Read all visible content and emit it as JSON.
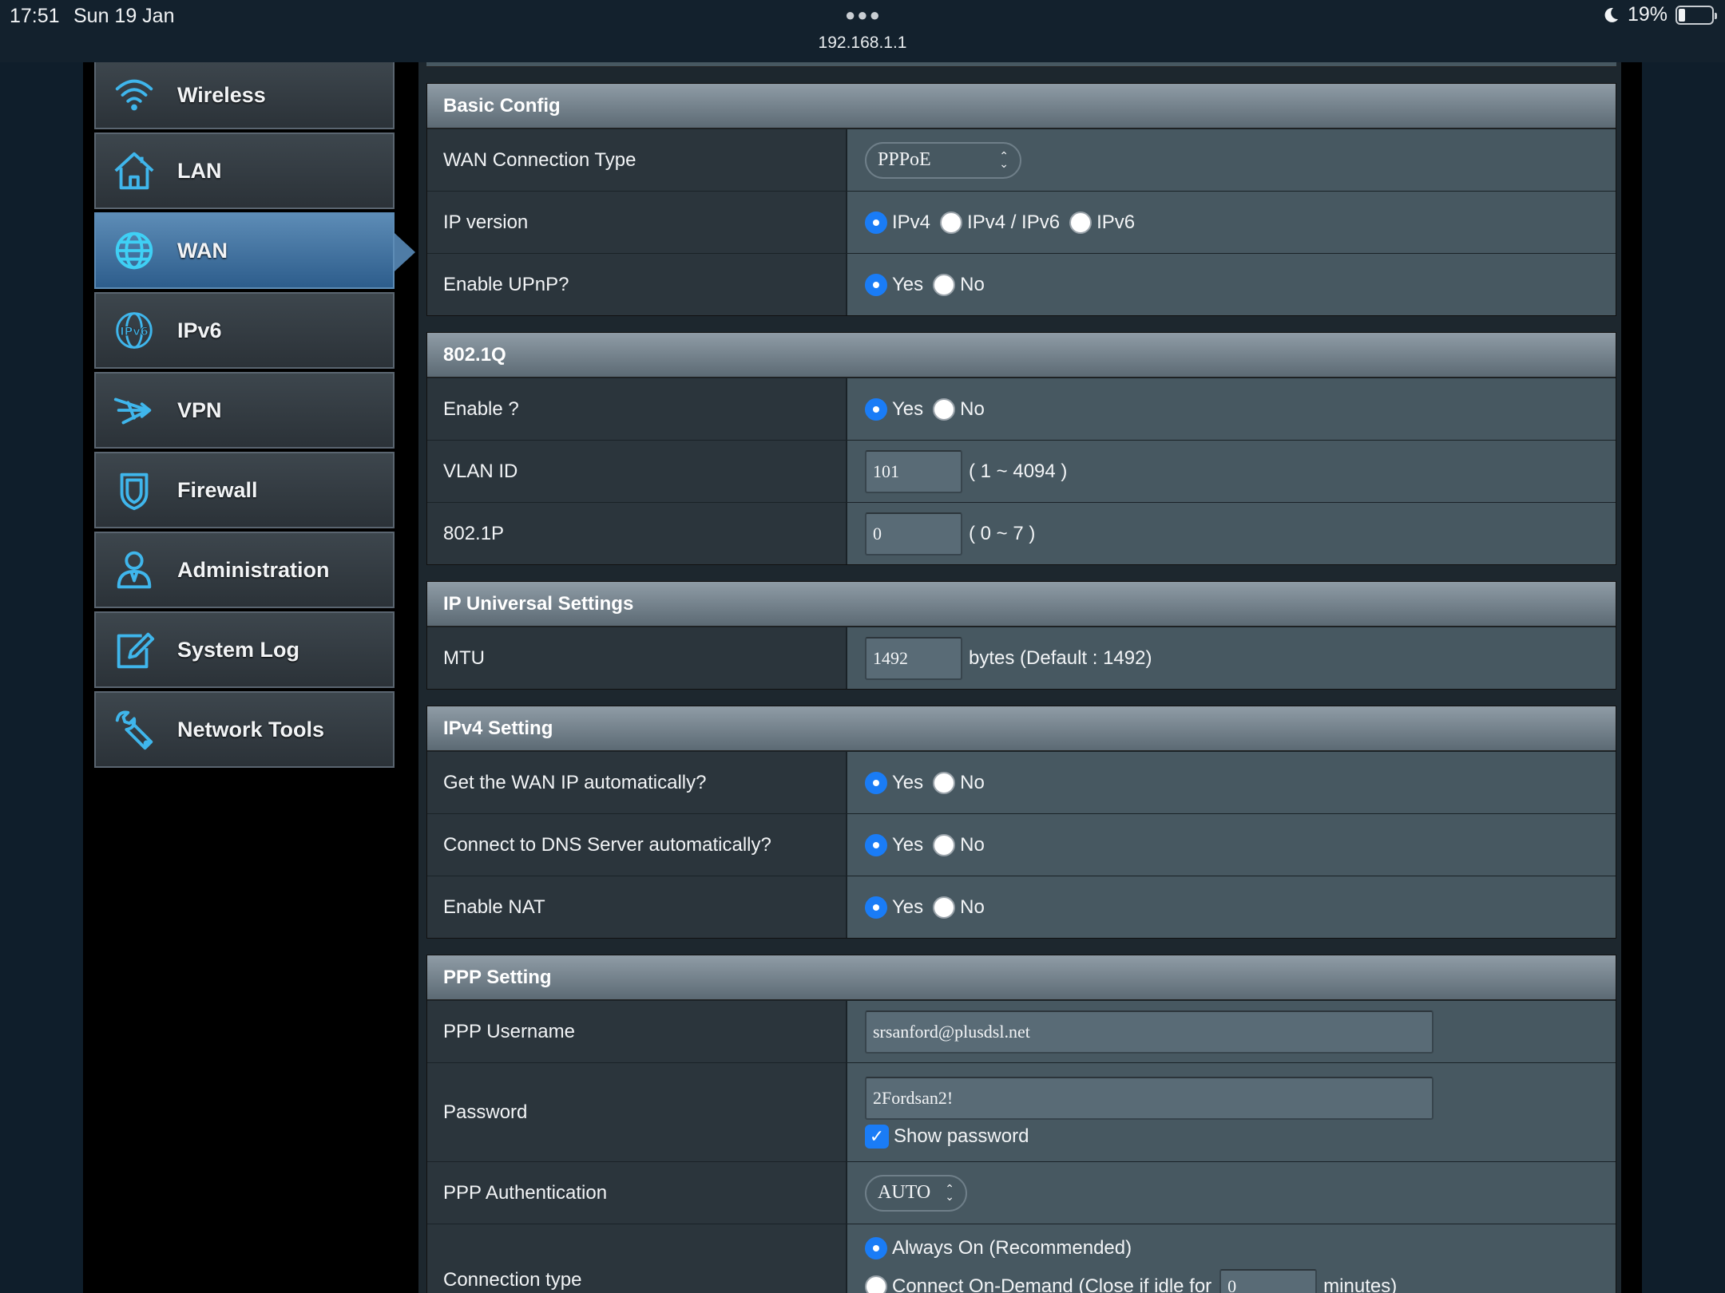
{
  "status_bar": {
    "time": "17:51",
    "date": "Sun 19 Jan",
    "url": "192.168.1.1",
    "battery": "19%",
    "battery_fraction": 0.19
  },
  "sidebar": {
    "items": [
      {
        "label": "Wireless",
        "icon": "wifi-icon"
      },
      {
        "label": "LAN",
        "icon": "home-icon"
      },
      {
        "label": "WAN",
        "icon": "globe-icon",
        "active": true
      },
      {
        "label": "IPv6",
        "icon": "ipv6-icon"
      },
      {
        "label": "VPN",
        "icon": "vpn-icon"
      },
      {
        "label": "Firewall",
        "icon": "shield-icon"
      },
      {
        "label": "Administration",
        "icon": "user-icon"
      },
      {
        "label": "System Log",
        "icon": "edit-icon"
      },
      {
        "label": "Network Tools",
        "icon": "tools-icon"
      }
    ]
  },
  "basic_config": {
    "title": "Basic Config",
    "wan_type_label": "WAN Connection Type",
    "wan_type_value": "PPPoE",
    "ip_version_label": "IP version",
    "ip_version_options": [
      "IPv4",
      "IPv4 / IPv6",
      "IPv6"
    ],
    "upnp_label": "Enable UPnP?"
  },
  "dot1q": {
    "title": "802.1Q",
    "enable_label": "Enable ?",
    "vlan_label": "VLAN ID",
    "vlan_value": "101",
    "vlan_hint": "( 1 ~ 4094 )",
    "p_label": "802.1P",
    "p_value": "0",
    "p_hint": "( 0 ~ 7 )"
  },
  "ip_universal": {
    "title": "IP Universal Settings",
    "mtu_label": "MTU",
    "mtu_value": "1492",
    "mtu_hint": "bytes (Default : 1492)"
  },
  "ipv4": {
    "title": "IPv4 Setting",
    "wan_ip_label": "Get the WAN IP automatically?",
    "dns_label": "Connect to DNS Server automatically?",
    "nat_label": "Enable NAT"
  },
  "ppp": {
    "title": "PPP Setting",
    "username_label": "PPP Username",
    "username_value": "srsanford@plusdsl.net",
    "password_label": "Password",
    "password_value": "2Fordsan2!",
    "show_password": "Show password",
    "auth_label": "PPP Authentication",
    "auth_value": "AUTO",
    "conn_type_label": "Connection type",
    "conn_always_on": "Always On (Recommended)",
    "conn_on_demand": "Connect On-Demand (Close if idle for",
    "idle_value": "0",
    "idle_unit": "minutes)"
  },
  "yes_no": {
    "yes": "Yes",
    "no": "No"
  }
}
